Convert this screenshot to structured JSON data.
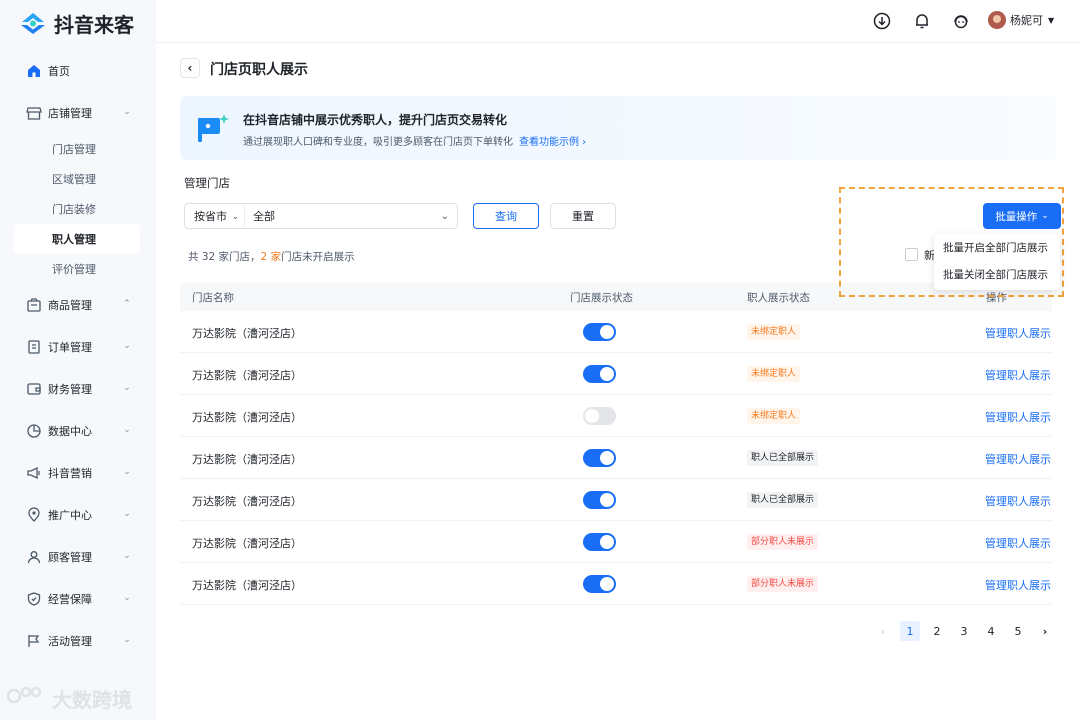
{
  "brand": {
    "name": "抖音来客"
  },
  "sidebar": {
    "items": [
      {
        "label": "首页",
        "icon": "home-icon",
        "has_chevron": false
      },
      {
        "label": "店铺管理",
        "icon": "store-icon",
        "has_chevron": true,
        "chevron": "down",
        "children": [
          "门店管理",
          "区域管理",
          "门店装修",
          "职人管理",
          "评价管理"
        ],
        "active_child": 3
      },
      {
        "label": "商品管理",
        "icon": "goods-icon",
        "has_chevron": true,
        "chevron": "up"
      },
      {
        "label": "订单管理",
        "icon": "order-icon",
        "has_chevron": true,
        "chevron": "down"
      },
      {
        "label": "财务管理",
        "icon": "finance-icon",
        "has_chevron": true,
        "chevron": "down"
      },
      {
        "label": "数据中心",
        "icon": "data-icon",
        "has_chevron": true,
        "chevron": "down"
      },
      {
        "label": "抖音营销",
        "icon": "marketing-icon",
        "has_chevron": true,
        "chevron": "down"
      },
      {
        "label": "推广中心",
        "icon": "promotion-icon",
        "has_chevron": true,
        "chevron": "down"
      },
      {
        "label": "顾客管理",
        "icon": "customer-icon",
        "has_chevron": true,
        "chevron": "down"
      },
      {
        "label": "经营保障",
        "icon": "shield-icon",
        "has_chevron": true,
        "chevron": "down"
      },
      {
        "label": "活动管理",
        "icon": "flag-icon",
        "has_chevron": true,
        "chevron": "down"
      }
    ]
  },
  "header": {
    "user_name": "杨妮可"
  },
  "page": {
    "title": "门店页职人展示",
    "banner": {
      "title": "在抖音店铺中展示优秀职人，提升门店页交易转化",
      "desc": "通过展现职人口碑和专业度，吸引更多顾客在门店页下单转化",
      "link": "查看功能示例 ›"
    },
    "filter": {
      "label": "管理门店",
      "region_select": "按省市",
      "store_select": "全部",
      "query_label": "查询",
      "reset_label": "重置"
    },
    "summary": {
      "prefix": "共 32 家门店，",
      "highlight": "2 家",
      "suffix": "门店未开启展示"
    },
    "batch": {
      "button_label": "批量操作",
      "menu": [
        "批量开启全部门店展示",
        "批量关闭全部门店展示"
      ],
      "checkbox_label": "新"
    },
    "table": {
      "columns": [
        "门店名称",
        "门店展示状态",
        "职人展示状态",
        "操作"
      ],
      "rows": [
        {
          "name": "万达影院（漕河泾店）",
          "store_on": true,
          "status": "未绑定职人",
          "status_type": "warn",
          "action": "管理职人展示"
        },
        {
          "name": "万达影院（漕河泾店）",
          "store_on": true,
          "status": "未绑定职人",
          "status_type": "warn",
          "action": "管理职人展示"
        },
        {
          "name": "万达影院（漕河泾店）",
          "store_on": false,
          "status": "未绑定职人",
          "status_type": "warn",
          "action": "管理职人展示"
        },
        {
          "name": "万达影院（漕河泾店）",
          "store_on": true,
          "status": "职人已全部展示",
          "status_type": "info",
          "action": "管理职人展示"
        },
        {
          "name": "万达影院（漕河泾店）",
          "store_on": true,
          "status": "职人已全部展示",
          "status_type": "info",
          "action": "管理职人展示"
        },
        {
          "name": "万达影院（漕河泾店）",
          "store_on": true,
          "status": "部分职人未展示",
          "status_type": "danger",
          "action": "管理职人展示"
        },
        {
          "name": "万达影院（漕河泾店）",
          "store_on": true,
          "status": "部分职人未展示",
          "status_type": "danger",
          "action": "管理职人展示"
        }
      ]
    },
    "pagination": {
      "prev": "‹",
      "pages": [
        "1",
        "2",
        "3",
        "4",
        "5"
      ],
      "current": "1",
      "next": "›"
    }
  },
  "watermark": {
    "text": "大数跨境"
  },
  "colors": {
    "primary": "#1a6ef5",
    "warn": "#f57a1f",
    "danger": "#f54a45",
    "highlight_border": "#f0a23b"
  }
}
